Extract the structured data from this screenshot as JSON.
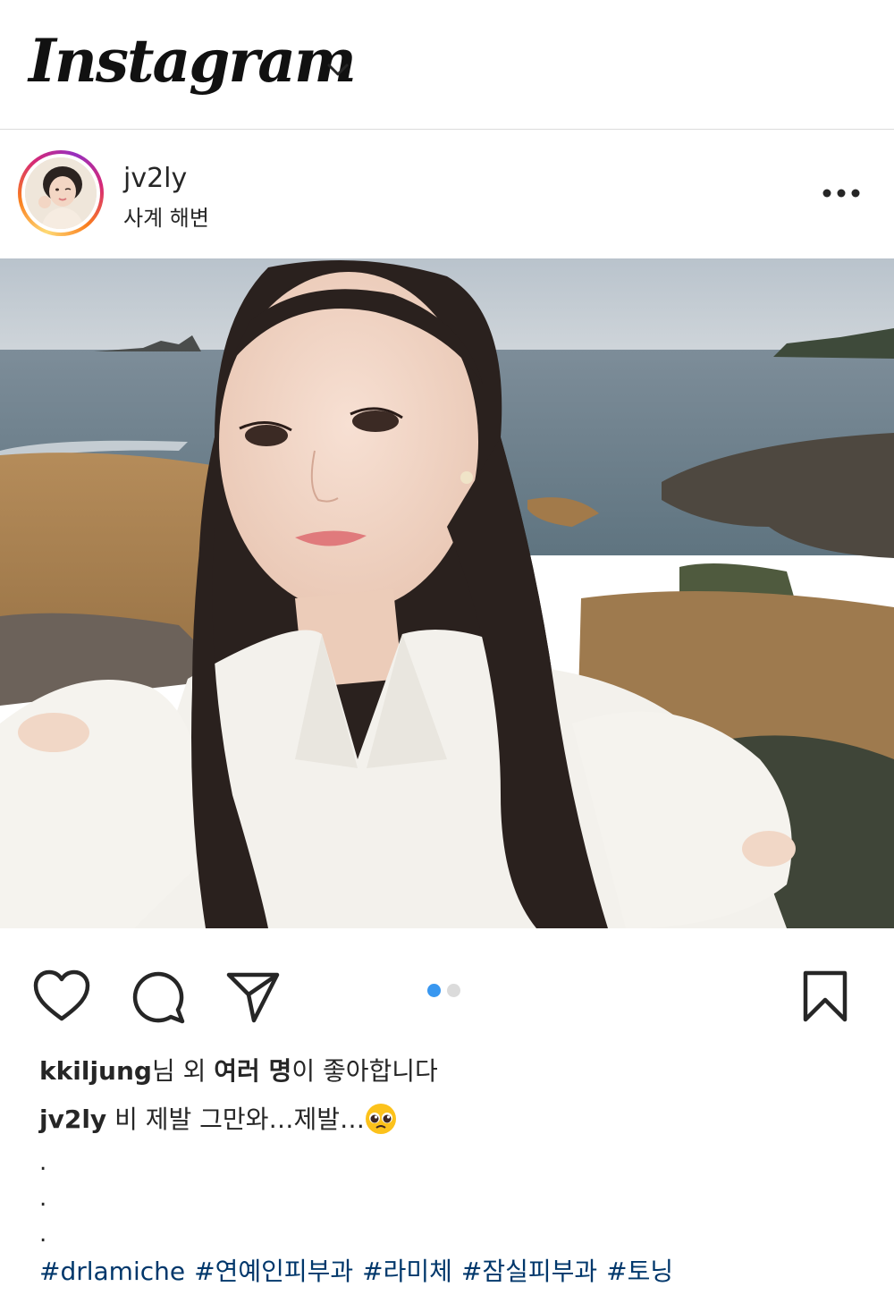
{
  "header": {
    "logo_text": "Instagram"
  },
  "post": {
    "username": "jv2ly",
    "location": "사계 해변",
    "carousel": {
      "total": 2,
      "current": 1,
      "active_color": "#3897f0",
      "inactive_color": "#dbdbdb"
    },
    "likes": {
      "user": "kkiljung",
      "middle": "님 외 ",
      "others": "여러 명",
      "suffix": "이 좋아합니다"
    },
    "caption": {
      "username": "jv2ly",
      "text": " 비 제발 그만와…제발…",
      "emoji": "pleading-face-emoji"
    },
    "caption_dots": [
      ".",
      ".",
      "."
    ],
    "hashtags": [
      "#drlamiche",
      "#연예인피부과",
      "#라미체",
      "#잠실피부과",
      "#토닝"
    ]
  }
}
